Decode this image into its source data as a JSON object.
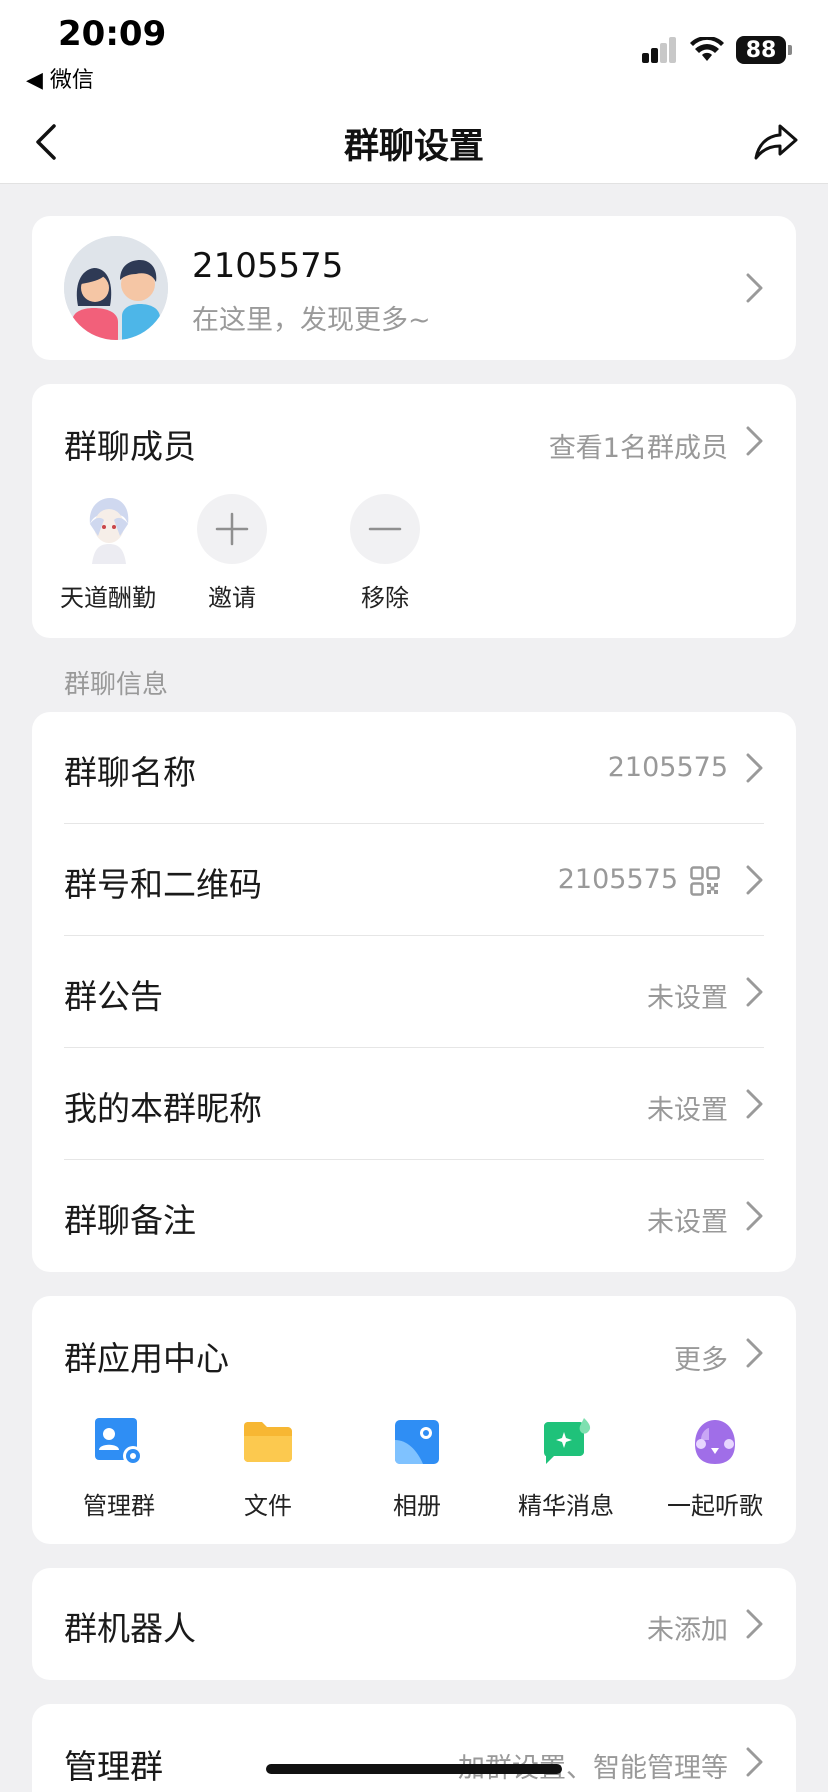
{
  "status": {
    "time": "20:09",
    "back_app": "◀ 微信",
    "battery": "88"
  },
  "nav": {
    "title": "群聊设置"
  },
  "profile": {
    "name": "2105575",
    "subtitle": "在这里，发现更多~"
  },
  "members": {
    "title": "群聊成员",
    "view_all": "查看1名群成员",
    "list": [
      {
        "label": "天道酬勤"
      },
      {
        "label": "邀请"
      },
      {
        "label": "移除"
      }
    ]
  },
  "info_section": {
    "label": "群聊信息",
    "rows": [
      {
        "title": "群聊名称",
        "value": "2105575"
      },
      {
        "title": "群号和二维码",
        "value": "2105575"
      },
      {
        "title": "群公告",
        "value": "未设置"
      },
      {
        "title": "我的本群昵称",
        "value": "未设置"
      },
      {
        "title": "群聊备注",
        "value": "未设置"
      }
    ]
  },
  "apps": {
    "title": "群应用中心",
    "more": "更多",
    "items": [
      {
        "label": "管理群",
        "icon": "admin-gear-icon",
        "color": "#2f8ef4"
      },
      {
        "label": "文件",
        "icon": "folder-icon",
        "color": "#f7b733"
      },
      {
        "label": "相册",
        "icon": "photo-album-icon",
        "color": "#2f8ef4"
      },
      {
        "label": "精华消息",
        "icon": "highlight-message-icon",
        "color": "#1fc27a"
      },
      {
        "label": "一起听歌",
        "icon": "listen-together-icon",
        "color": "#a06ee8"
      }
    ]
  },
  "bots": {
    "title": "群机器人",
    "value": "未添加"
  },
  "admin": {
    "title": "管理群",
    "value": "加群设置、智能管理等"
  }
}
